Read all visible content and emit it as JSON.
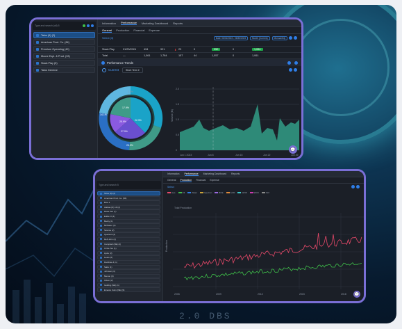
{
  "window_a": {
    "search_placeholder": "Type and search (all) 5",
    "side_items": [
      {
        "label": "Talos (9)  (2)",
        "sel": true
      },
      {
        "label": "American Prod. Co.  (84)",
        "sel": false
      },
      {
        "label": "Premium Operating  (49)",
        "sel": false
      },
      {
        "label": "Moore Expl. & Prod.  (33)",
        "sel": false
      },
      {
        "label": "Stack Play  (5)",
        "sel": false
      },
      {
        "label": "Talos General",
        "sel": false
      }
    ],
    "tabs": [
      "Information",
      "Performance",
      "Marketing Dashboard",
      "Reports"
    ],
    "subtabs": [
      "General",
      "Production",
      "Financial",
      "Expense"
    ],
    "filter_label": "Select (3)",
    "chips": [
      "Date: 06/01/2022 - 06/30/2023",
      "Month (Current)",
      "Monoanthly"
    ],
    "rows": [
      {
        "name": "Stack Play",
        "date": "01/23/2024",
        "a": "494",
        "b": "921",
        "c": "23",
        "d": "0",
        "e": "250",
        "f": "0",
        "g": "1,064"
      },
      {
        "name": "Total",
        "date": "—",
        "a": "1,061",
        "b": "1,784",
        "c": "157",
        "d": "44",
        "e": "1,057",
        "f": "0",
        "g": "1,061"
      }
    ],
    "perf_title": "Performance Trends",
    "current_label": "Current",
    "term_label": "Short Term",
    "donut_labels": [
      "1.0%",
      "17.9%",
      "25.9%",
      "27.9%",
      "22.3%",
      "34.1%",
      "26.9%"
    ],
    "chart_ylabel": "Volume (M)",
    "chart_ticks": [
      "2.0",
      "1.5",
      "1.0",
      "0.5",
      "0"
    ],
    "chart_xticks": [
      "Jun 1 2023",
      "Jun 8",
      "Jun 15",
      "Jun 22",
      "Jun 29"
    ]
  },
  "window_b": {
    "search_placeholder": "Type and search 5",
    "side_items": [
      "Talos (9)  (2)",
      "American Prod. Co.  (84)",
      "Bow 1",
      "Alabaa (N) 19 (2)",
      "Rasa Paz (7)",
      "Eddie O (4)",
      "Becky (1)",
      "McKaren (1)",
      "Sewme (2)",
      "Quarterit (2)",
      "Refl John (1)",
      "Campbell (NE) (1)",
      "Circle Tex (1)",
      "Hyde (3)",
      "Lewis (6)",
      "Darkhaw 4 (1)",
      "Sabo (1)",
      "Johnson (3)",
      "Menon (3)",
      "Odum (2)",
      "Golding (NE) (1)",
      "Emesto Kolm (NE) (3)"
    ],
    "tabs": [
      "Information",
      "Performance",
      "Marketing Dashboard",
      "Reports"
    ],
    "subtabs": [
      "General",
      "Production",
      "Financial",
      "Expense"
    ],
    "filter_label": "Select",
    "legend": [
      "Gas",
      "Oil",
      "Water",
      "Injection",
      "BOE",
      "GOR",
      "WOR",
      "WOC",
      "Mcf"
    ],
    "chart_title": "Total Production",
    "y_label": "Production",
    "x_ticks": [
      "2006",
      "2009",
      "2012",
      "2015",
      "2018"
    ]
  },
  "colors": {
    "accent": "#7a6fd6",
    "blue": "#2f7ee8",
    "teal": "#3f9b88",
    "gas": "#e8496a",
    "oil": "#3fbf4a"
  },
  "background_text": "2.0 DBS"
}
